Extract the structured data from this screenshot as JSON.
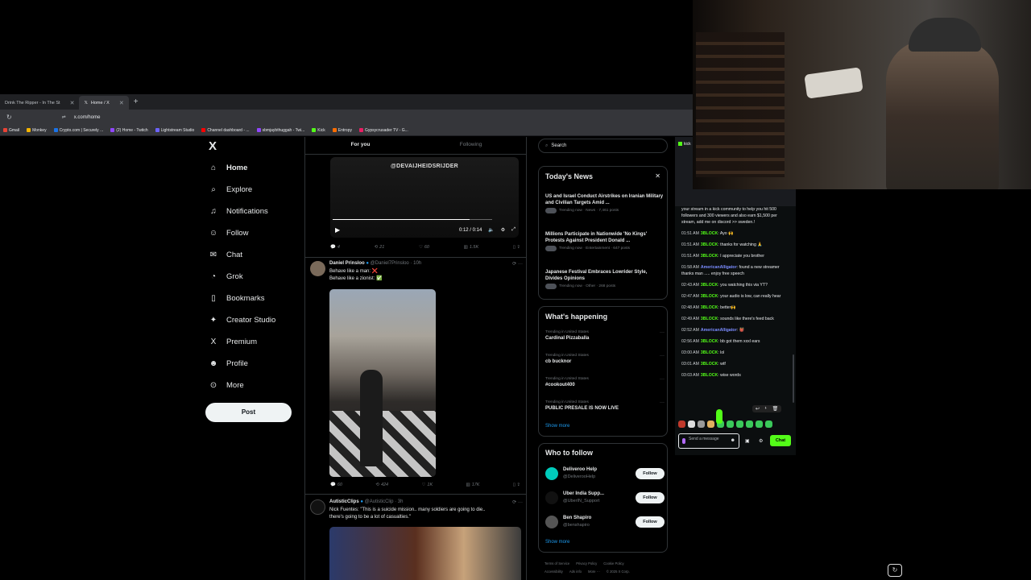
{
  "browser": {
    "tabs": [
      {
        "label": "Drink The Ripper - In The St",
        "active": false
      },
      {
        "label": "Home / X",
        "active": true
      }
    ],
    "url": "x.com/home",
    "bookmarks": [
      {
        "label": "Gmail",
        "color": "#ea4335"
      },
      {
        "label": "Monkey",
        "color": "#f4b400"
      },
      {
        "label": "Crypto.com | Securely ...",
        "color": "#1a73e8"
      },
      {
        "label": "(2) Home - Twitch",
        "color": "#9146ff"
      },
      {
        "label": "Lightstream Studio",
        "color": "#6c63ff"
      },
      {
        "label": "Channel dashboard - ...",
        "color": "#ff0000"
      },
      {
        "label": "sbmjaybthuggah - Twi...",
        "color": "#9146ff"
      },
      {
        "label": "Kick",
        "color": "#53fc18"
      },
      {
        "label": "Entropy",
        "color": "#ff6d00"
      },
      {
        "label": "Gypsycrusader TV - G...",
        "color": "#e91e63"
      }
    ]
  },
  "nav": {
    "logo": "X",
    "items": [
      {
        "label": "Home",
        "icon": "home-icon",
        "glyph": "⌂"
      },
      {
        "label": "Explore",
        "icon": "search-icon",
        "glyph": "⌕"
      },
      {
        "label": "Notifications",
        "icon": "bell-icon",
        "glyph": "♫"
      },
      {
        "label": "Follow",
        "icon": "person-add-icon",
        "glyph": "☺"
      },
      {
        "label": "Chat",
        "icon": "mail-icon",
        "glyph": "✉"
      },
      {
        "label": "Grok",
        "icon": "grok-icon",
        "glyph": "◔"
      },
      {
        "label": "Bookmarks",
        "icon": "bookmark-icon",
        "glyph": "▯"
      },
      {
        "label": "Creator Studio",
        "icon": "creator-studio-icon",
        "glyph": "✦"
      },
      {
        "label": "Premium",
        "icon": "x-premium-icon",
        "glyph": "X"
      },
      {
        "label": "Profile",
        "icon": "profile-icon",
        "glyph": "☻"
      },
      {
        "label": "More",
        "icon": "more-circle-icon",
        "glyph": "⊙"
      }
    ],
    "post_label": "Post"
  },
  "timeline": {
    "tabs": [
      "For you",
      "Following"
    ],
    "video1": {
      "watermark": "@DEVAIJHEIDSRIJDER",
      "time": "0:12 / 0:14",
      "progress": 0.86
    },
    "post1_actions": {
      "replies": "4",
      "reposts": "21",
      "likes": "60",
      "views": "1.5K"
    },
    "post2": {
      "name": "Daniel Prinsloo",
      "handle": "@Daniel7Prinsloo · 10h",
      "line1": "Behave like a man: ❌",
      "line2": "Behave like a zionist: ✅"
    },
    "post2_actions": {
      "replies": "60",
      "reposts": "424",
      "likes": "1K",
      "views": "17K"
    },
    "post3": {
      "name": "AutisticClips",
      "handle": "@AutisticClip · 3h",
      "line1": "Nick Fuentes: \"This is a suicide mission.. many soldiers are going to die..",
      "line2": "there's going to be a lot of casualties.\""
    }
  },
  "right": {
    "search_placeholder": "Search",
    "news": {
      "title": "Today's News",
      "items": [
        {
          "headline": "US and Israel Conduct Airstrikes on Iranian Military and Civilian Targets Amid ...",
          "meta": "Trending now · News · 7,461 posts"
        },
        {
          "headline": "Millions Participate in Nationwide 'No Kings' Protests Against President Donald ...",
          "meta": "Trending now · Entertainment · 647 posts"
        },
        {
          "headline": "Japanese Festival Embraces Lowrider Style, Divides Opinions",
          "meta": "Trending now · Other · 268 posts"
        }
      ]
    },
    "happening": {
      "title": "What's happening",
      "items": [
        {
          "context": "Trending in United States",
          "topic": "Cardinal Pizzaballa"
        },
        {
          "context": "Trending in United States",
          "topic": "cb bucknor"
        },
        {
          "context": "Trending in United States",
          "topic": "#cookout400"
        },
        {
          "context": "Trending in United States",
          "topic": "PUBLIC PRESALE IS NOW LIVE"
        }
      ],
      "show_more": "Show more"
    },
    "who": {
      "title": "Who to follow",
      "items": [
        {
          "name": "Deliveroo Help",
          "handle": "@DeliverooHelp",
          "color": "#00ccbc"
        },
        {
          "name": "Uber India Supp...",
          "handle": "@UberIN_Support",
          "color": "#111111"
        },
        {
          "name": "Ben Shapiro",
          "handle": "@benshapiro",
          "color": "#555555"
        }
      ],
      "follow_label": "Follow",
      "show_more": "Show more"
    },
    "footer": {
      "line1": [
        "Terms of Service",
        "Privacy Policy",
        "Cookie Policy"
      ],
      "line2": [
        "Accessibility",
        "Ads info",
        "More ···",
        "© 2025 X Corp."
      ]
    }
  },
  "chat": {
    "top_label": "kick",
    "messages": [
      {
        "ts": "",
        "user": "",
        "text": "your stream in a kick community to help you hit 500 followers and 300 viewers and also earn $1,500 per stream, add me on discord >> sweden.!",
        "ucls": "u1"
      },
      {
        "ts": "01:51 AM",
        "user": "3BLOCK",
        "text": ": Ayo 🙌",
        "ucls": "u1"
      },
      {
        "ts": "01:51 AM",
        "user": "3BLOCK",
        "text": ": thanks for watching 🙏",
        "ucls": "u1"
      },
      {
        "ts": "01:51 AM",
        "user": "3BLOCK",
        "text": ": I appreciate you brother",
        "ucls": "u1"
      },
      {
        "ts": "01:58 AM",
        "user": "AmericanAlligator",
        "text": ": found a new streamer thanks man ..... enjoy free speech",
        "ucls": "u2"
      },
      {
        "ts": "02:43 AM",
        "user": "3BLOCK",
        "text": ": you watching this via YT?",
        "ucls": "u1"
      },
      {
        "ts": "02:47 AM",
        "user": "3BLOCK",
        "text": ": your audio is low, can really hear",
        "ucls": "u1"
      },
      {
        "ts": "02:48 AM",
        "user": "3BLOCK",
        "text": ": better🙌",
        "ucls": "u1"
      },
      {
        "ts": "02:49 AM",
        "user": "3BLOCK",
        "text": ": sounds like there's feed back",
        "ucls": "u1"
      },
      {
        "ts": "02:52 AM",
        "user": "AmericanAlligator",
        "text": ": 👹",
        "ucls": "u2"
      },
      {
        "ts": "02:56 AM",
        "user": "3BLOCK",
        "text": ": bb got them xxxl ears",
        "ucls": "u1"
      },
      {
        "ts": "03:00 AM",
        "user": "3BLOCK",
        "text": ": lol",
        "ucls": "u1"
      },
      {
        "ts": "03:01 AM",
        "user": "3BLOCK",
        "text": ": wtf",
        "ucls": "u1"
      },
      {
        "ts": "03:03 AM",
        "user": "3BLOCK",
        "text": ": wise words",
        "ucls": "u1"
      }
    ],
    "input_placeholder": "Send a message",
    "chat_button": "Chat",
    "accent": "#53fc18"
  }
}
